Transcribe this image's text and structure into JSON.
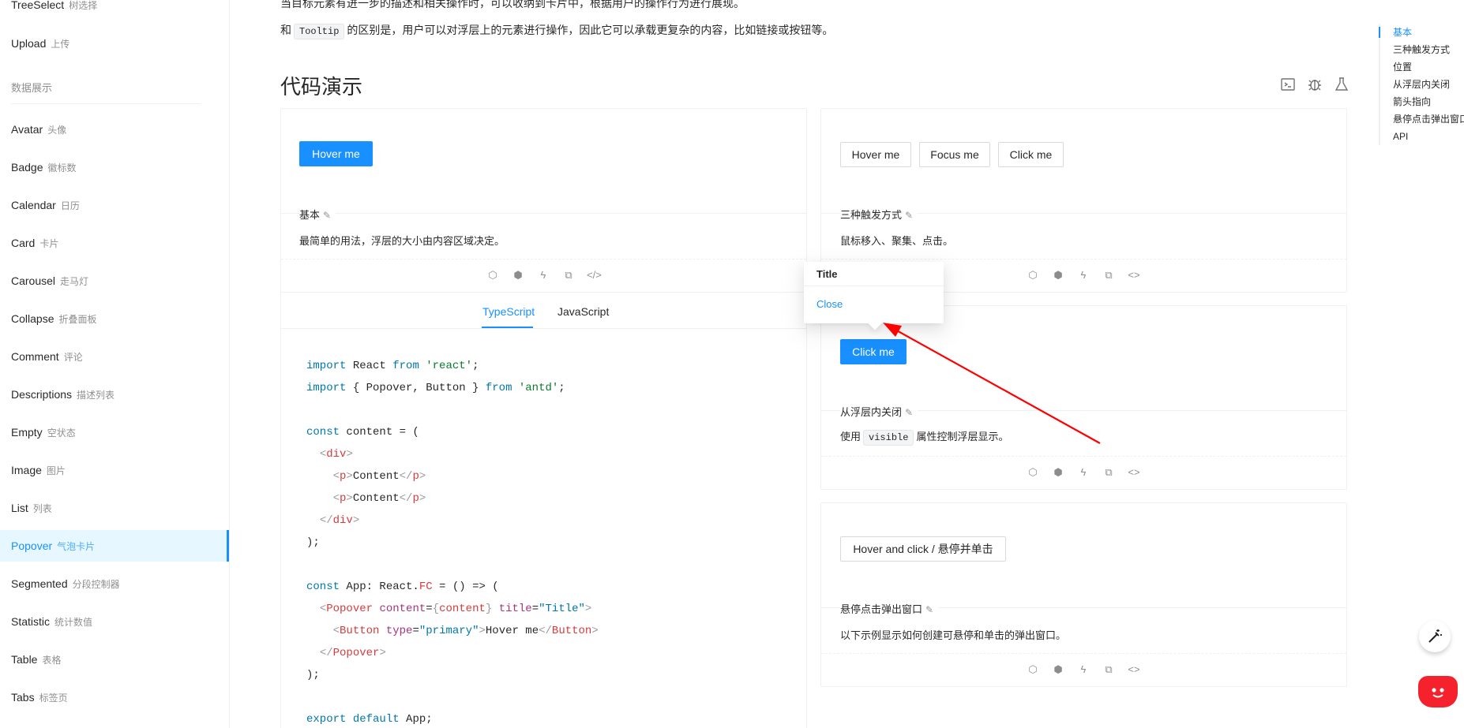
{
  "sidebar": {
    "items_top": [
      {
        "label": "TreeSelect",
        "sub": "树选择"
      },
      {
        "label": "Upload",
        "sub": "上传"
      }
    ],
    "group_label": "数据展示",
    "items": [
      {
        "label": "Avatar",
        "sub": "头像"
      },
      {
        "label": "Badge",
        "sub": "徽标数"
      },
      {
        "label": "Calendar",
        "sub": "日历"
      },
      {
        "label": "Card",
        "sub": "卡片"
      },
      {
        "label": "Carousel",
        "sub": "走马灯"
      },
      {
        "label": "Collapse",
        "sub": "折叠面板"
      },
      {
        "label": "Comment",
        "sub": "评论"
      },
      {
        "label": "Descriptions",
        "sub": "描述列表"
      },
      {
        "label": "Empty",
        "sub": "空状态"
      },
      {
        "label": "Image",
        "sub": "图片"
      },
      {
        "label": "List",
        "sub": "列表"
      },
      {
        "label": "Popover",
        "sub": "气泡卡片"
      },
      {
        "label": "Segmented",
        "sub": "分段控制器"
      },
      {
        "label": "Statistic",
        "sub": "统计数值"
      },
      {
        "label": "Table",
        "sub": "表格"
      },
      {
        "label": "Tabs",
        "sub": "标签页"
      }
    ]
  },
  "intro": {
    "line_top": "当目标元素有进一步的描述和相关操作时，可以收纳到卡片中，根据用户的操作行为进行展现。",
    "line_pre": "和",
    "code": "Tooltip",
    "line_post": "的区别是，用户可以对浮层上的元素进行操作，因此它可以承载更复杂的内容，比如链接或按钮等。"
  },
  "section_title": "代码演示",
  "demos": {
    "basic": {
      "button": "Hover me",
      "title": "基本",
      "desc": "最简单的用法，浮层的大小由内容区域决定。"
    },
    "trigger": {
      "buttons": [
        "Hover me",
        "Focus me",
        "Click me"
      ],
      "title": "三种触发方式",
      "desc": "鼠标移入、聚集、点击。"
    },
    "close": {
      "button": "Click me",
      "title": "从浮层内关闭",
      "desc_pre": "使用",
      "code": "visible",
      "desc_post": "属性控制浮层显示。"
    },
    "hover_click": {
      "button": "Hover and click / 悬停并单击",
      "title": "悬停点击弹出窗口",
      "desc": "以下示例显示如何创建可悬停和单击的弹出窗口。"
    }
  },
  "tabs": [
    "TypeScript",
    "JavaScript"
  ],
  "popover": {
    "title": "Title",
    "close": "Close"
  },
  "anchor": [
    "基本",
    "三种触发方式",
    "位置",
    "从浮层内关闭",
    "箭头指向",
    "悬停点击弹出窗口",
    "API"
  ]
}
